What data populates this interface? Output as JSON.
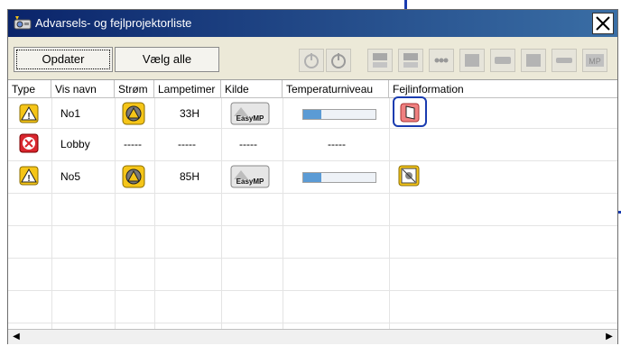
{
  "window": {
    "title": "Advarsels- og fejlprojektorliste"
  },
  "toolbar": {
    "update_label": "Opdater",
    "select_all_label": "Vælg alle"
  },
  "table": {
    "headers": [
      "Type",
      "Vis navn",
      "Strøm",
      "Lampetimer",
      "Kilde",
      "Temperaturniveau",
      "Fejlinformation"
    ],
    "rows": [
      {
        "type": "warning-icon",
        "name": "No1",
        "power": "power-warning-icon",
        "lamp_hours": "33H",
        "source": "EasyMP",
        "temperature_level": 0.25,
        "error_info": "error-door-icon"
      },
      {
        "type": "error-icon",
        "name": "Lobby",
        "power": "-----",
        "lamp_hours": "-----",
        "source": "-----",
        "temperature_text": "-----",
        "error_info": ""
      },
      {
        "type": "warning-icon",
        "name": "No5",
        "power": "power-warning-icon",
        "lamp_hours": "85H",
        "source": "EasyMP",
        "temperature_level": 0.25,
        "error_info": "error-fan-icon"
      }
    ]
  },
  "colors": {
    "accent": "#1a3cb0",
    "warning": "#f5c518",
    "error": "#d9262e",
    "temperature_fill": "#5b9bd5"
  }
}
